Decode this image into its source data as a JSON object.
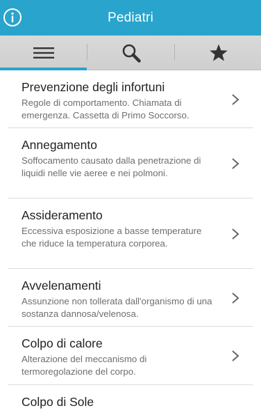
{
  "app": {
    "title": "Pediatri",
    "header_color": "#29a4cc"
  },
  "tabs": [
    {
      "icon": "menu-icon",
      "selected": true
    },
    {
      "icon": "search-icon",
      "selected": false
    },
    {
      "icon": "star-icon",
      "selected": false
    }
  ],
  "items": [
    {
      "title": "Prevenzione degli infortuni",
      "description": "Regole di comportamento. Chiamata di emergenza. Cassetta di Primo Soccorso."
    },
    {
      "title": "Annegamento",
      "description": "Soffocamento causato dalla penetrazione di liquidi nelle vie aeree e nei polmoni."
    },
    {
      "title": "Assideramento",
      "description": "Eccessiva esposizione a basse temperature che riduce la temperatura corporea."
    },
    {
      "title": "Avvelenamenti",
      "description": "Assunzione non tollerata dall'organismo di una sostanza dannosa/velenosa."
    },
    {
      "title": "Colpo di calore",
      "description": "Alterazione del meccanismo di termoregolazione del corpo."
    },
    {
      "title": "Colpo di Sole",
      "description": ""
    }
  ]
}
